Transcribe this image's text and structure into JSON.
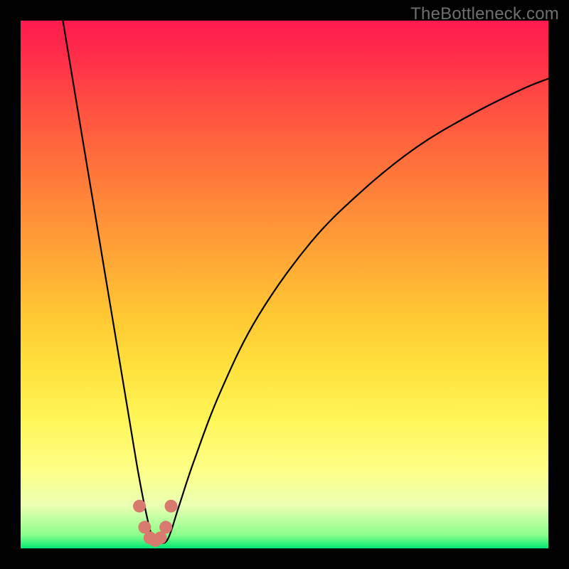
{
  "watermark": "TheBottleneck.com",
  "chart_data": {
    "type": "line",
    "title": "",
    "xlabel": "",
    "ylabel": "",
    "xlim": [
      0,
      100
    ],
    "ylim": [
      0,
      100
    ],
    "grid": false,
    "series": [
      {
        "name": "bottleneck-curve",
        "x": [
          8,
          10,
          12,
          14,
          16,
          18,
          20,
          22,
          23.5,
          25,
          26.5,
          28,
          30,
          33,
          38,
          45,
          55,
          65,
          75,
          85,
          95,
          100
        ],
        "values": [
          100,
          88,
          76,
          64,
          52,
          40,
          28,
          16,
          8,
          2,
          1,
          2,
          8,
          17,
          30,
          44,
          58,
          68,
          76,
          82,
          87,
          89
        ]
      }
    ],
    "marker": {
      "name": "highlight-dots",
      "color": "#d87a6e",
      "x": [
        22.5,
        23.5,
        24.5,
        25.5,
        26.5,
        27.5,
        28.5
      ],
      "values": [
        8,
        4,
        2,
        1.5,
        2,
        4,
        8
      ]
    },
    "colors": {
      "curve": "#000000",
      "background_top": "#ff1a4f",
      "background_mid": "#ffe23d",
      "background_bottom": "#00e874"
    }
  }
}
